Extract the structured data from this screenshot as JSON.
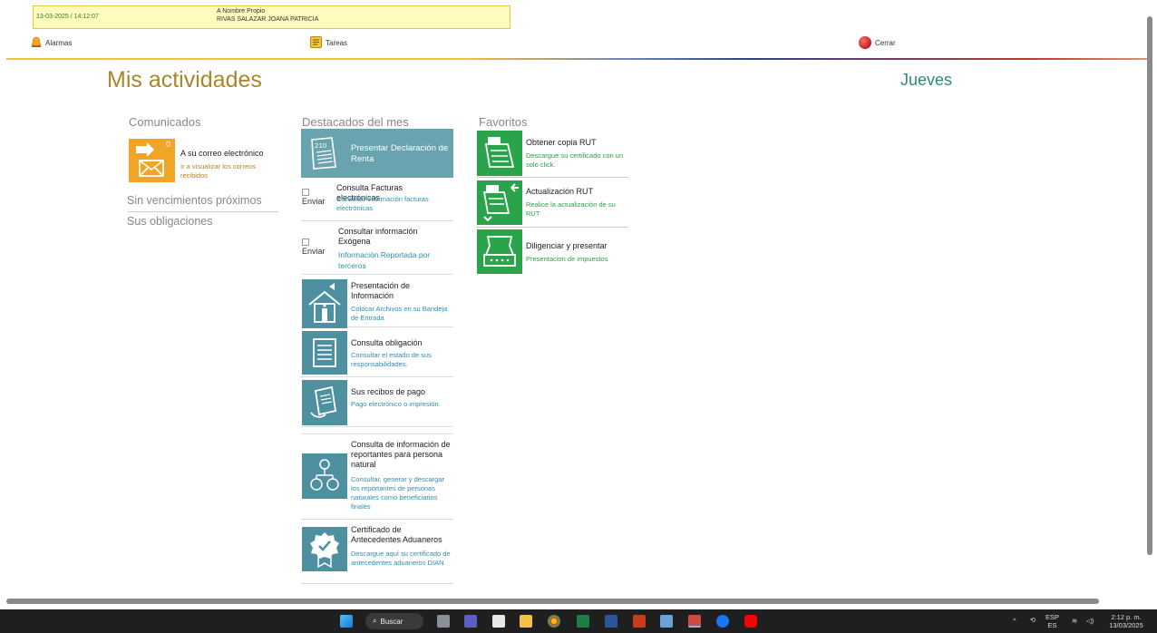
{
  "infobar": {
    "datetime": "13-03-2025 / 14:12:07",
    "role": "A Nombre Propio",
    "name": "RIVAS SALAZAR JOANA PATRICIA"
  },
  "topnav": {
    "alarms": "Alarmas",
    "tasks": "Tareas",
    "close": "Cerrar"
  },
  "page": {
    "title": "Mis actividades",
    "day": "Jueves"
  },
  "comunicados": {
    "heading": "Comunicados",
    "mail_count": "0",
    "mail_title": "A su correo electrónico",
    "mail_sub": "Ir a visualizar los correos recibidos",
    "link1": "Sin vencimientos próximos",
    "link2": "Sus obligaciones"
  },
  "destacados": {
    "heading": "Destacados del mes",
    "featured": {
      "title": "Presentar Declaración de Renta",
      "badge": "210"
    },
    "items": [
      {
        "title": "Consulta Facturas electrónicas",
        "sub": "Consultar información facturas electrónicas",
        "alt": "Enviar"
      },
      {
        "title": "Consultar información Exógena",
        "sub": "Información Reportada por terceros",
        "alt": "Enviar"
      },
      {
        "title": "Presentación de Información",
        "sub": "Colocar Archivos en su Bandeja de Entrada"
      },
      {
        "title": "Consulta obligación",
        "sub": "Consultar el estado de sus responsabilidades."
      },
      {
        "title": "Sus recibos de pago",
        "sub": "Pago electrónico o impresión."
      },
      {
        "title": "Consulta de información de reportantes para persona natural",
        "sub": "Consultar, generar y descargar los reportantes de personas naturales como beneficiarios finales"
      },
      {
        "title": "Certificado de Antecedentes Aduaneros",
        "sub": "Descargue aquí su certificado de antecedentes aduaneros DIAN"
      }
    ]
  },
  "favoritos": {
    "heading": "Favoritos",
    "items": [
      {
        "title": "Obtener copia RUT",
        "sub": "Descargue su certificado con un solo click."
      },
      {
        "title": "Actualización RUT",
        "sub": "Realice la actualización de su RUT"
      },
      {
        "title": "Diligenciar y presentar",
        "sub": "Presentacion de impuestos"
      }
    ]
  },
  "taskbar": {
    "search": "Buscar",
    "lang_top": "ESP",
    "lang_bottom": "ES",
    "time": "2:12 p. m.",
    "date": "13/03/2025"
  },
  "colors": {
    "gold": "#a8862a",
    "teal": "#4e8fa0",
    "green": "#2aa44a",
    "orange": "#f0a526"
  }
}
